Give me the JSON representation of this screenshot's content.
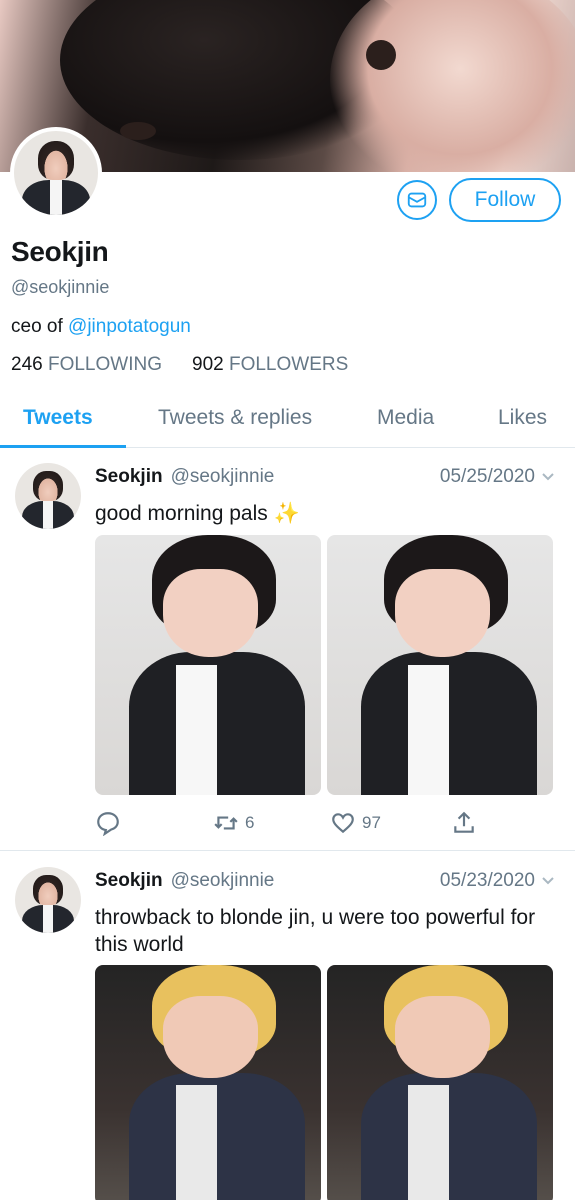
{
  "profile": {
    "name": "Seokjin",
    "handle": "@seokjinnie",
    "bio_prefix": "ceo of ",
    "bio_mention": "@jinpotatogun",
    "following_count": "246",
    "following_label": "FOLLOWING",
    "followers_count": "902",
    "followers_label": "FOLLOWERS"
  },
  "actions": {
    "follow_label": "Follow",
    "dm_icon": "envelope-icon"
  },
  "tabs": [
    {
      "label": "Tweets",
      "active": true
    },
    {
      "label": "Tweets & replies",
      "active": false
    },
    {
      "label": "Media",
      "active": false
    },
    {
      "label": "Likes",
      "active": false
    }
  ],
  "tweets": [
    {
      "author": "Seokjin",
      "handle": "@seokjinnie",
      "date": "05/25/2020",
      "text": "good morning pals ",
      "emoji": "✨",
      "replies": "",
      "retweets": "6",
      "likes": "97"
    },
    {
      "author": "Seokjin",
      "handle": "@seokjinnie",
      "date": "05/23/2020",
      "text": "throwback to blonde jin, u were too powerful for this world"
    }
  ],
  "colors": {
    "accent": "#1da1f2",
    "secondary_text": "#657786",
    "divider": "#e1e8ed"
  }
}
